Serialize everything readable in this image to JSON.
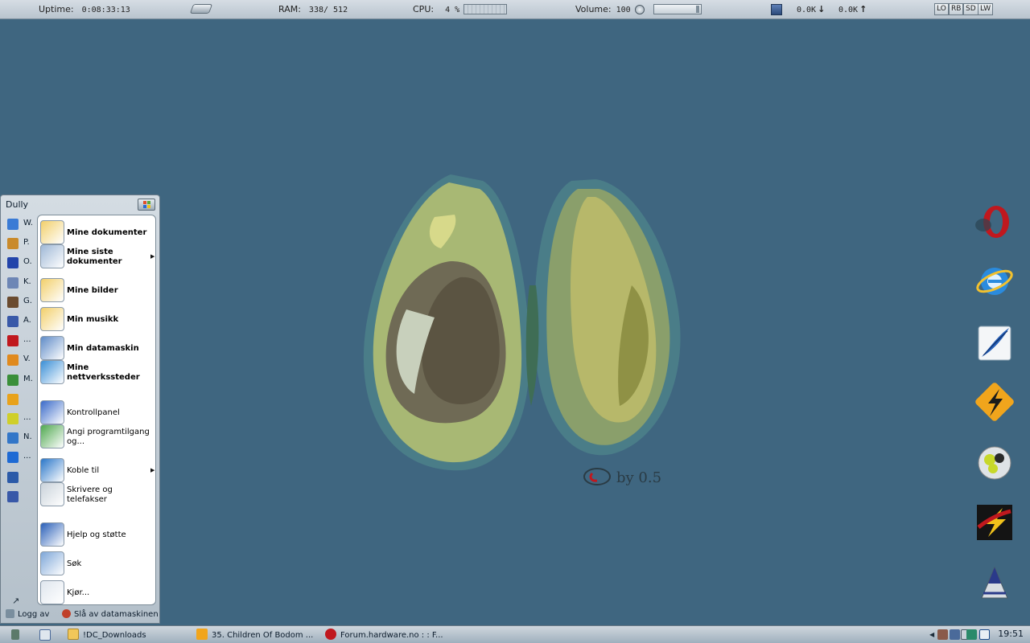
{
  "statusbar": {
    "uptime_label": "Uptime:",
    "uptime_value": "0:08:33:13",
    "ram_label": "RAM:",
    "ram_value": "338/ 512",
    "cpu_label": "CPU:",
    "cpu_value": "4 %",
    "volume_label": "Volume:",
    "volume_value": "100 %",
    "net_down": "0.0K",
    "net_up": "0.0K",
    "buttons": [
      "LO",
      "RB",
      "SD",
      "LW"
    ]
  },
  "wallpaper": {
    "signature": "by 0.5"
  },
  "dock": {
    "icons": [
      "opera-icon",
      "internet-explorer-icon",
      "feather-icon",
      "winamp-icon",
      "media-player-icon",
      "flashget-icon",
      "vlc-cone-icon"
    ]
  },
  "startmenu": {
    "user": "Dully",
    "left_items": [
      {
        "label": "W.",
        "icon": "windows-flag-icon",
        "color": "#3a7bd5"
      },
      {
        "label": "P.",
        "icon": "paint-icon",
        "color": "#c98a2b"
      },
      {
        "label": "O.",
        "icon": "calendar-icon",
        "color": "#2244aa"
      },
      {
        "label": "K.",
        "icon": "notepad-icon",
        "color": "#6d86b5"
      },
      {
        "label": "G.",
        "icon": "game-icon",
        "color": "#6a4b2f"
      },
      {
        "label": "A.",
        "icon": "app-icon",
        "color": "#3959a8"
      },
      {
        "label": "...",
        "icon": "opera-small-icon",
        "color": "#c0181e"
      },
      {
        "label": "V.",
        "icon": "vlc-small-icon",
        "color": "#e08a1e"
      },
      {
        "label": "M.",
        "icon": "messenger-icon",
        "color": "#3a8f3a"
      },
      {
        "label": "",
        "icon": "winamp-small-icon",
        "color": "#e8a21b"
      },
      {
        "label": "...",
        "icon": "media-small-icon",
        "color": "#cfcf2a"
      },
      {
        "label": "N.",
        "icon": "network-icon",
        "color": "#3276c8"
      },
      {
        "label": "...",
        "icon": "ie-small-icon",
        "color": "#1e6ad4"
      },
      {
        "label": "",
        "icon": "photoshop-icon",
        "color": "#2b5aa8"
      },
      {
        "label": "",
        "icon": "figure-icon",
        "color": "#3858a8"
      }
    ],
    "right_items": [
      {
        "label": "Mine dokumenter",
        "bold": true,
        "icon": "my-documents-icon",
        "arrow": false
      },
      {
        "label": "Mine siste dokumenter",
        "bold": true,
        "icon": "recent-documents-icon",
        "arrow": true
      },
      {
        "label": "Mine bilder",
        "bold": true,
        "icon": "my-pictures-icon",
        "arrow": false
      },
      {
        "label": "Min musikk",
        "bold": true,
        "icon": "my-music-icon",
        "arrow": false
      },
      {
        "label": "Min datamaskin",
        "bold": true,
        "icon": "my-computer-icon",
        "arrow": false
      },
      {
        "label": "Mine nettverkssteder",
        "bold": true,
        "icon": "network-places-icon",
        "arrow": false
      },
      {
        "label": "Kontrollpanel",
        "bold": false,
        "icon": "control-panel-icon",
        "arrow": false
      },
      {
        "label": "Angi programtilgang og...",
        "bold": false,
        "icon": "program-access-icon",
        "arrow": false
      },
      {
        "label": "Koble til",
        "bold": false,
        "icon": "connect-icon",
        "arrow": true
      },
      {
        "label": "Skrivere og telefakser",
        "bold": false,
        "icon": "printer-icon",
        "arrow": false
      },
      {
        "label": "Hjelp og støtte",
        "bold": false,
        "icon": "help-icon",
        "arrow": false
      },
      {
        "label": "Søk",
        "bold": false,
        "icon": "search-icon",
        "arrow": false
      },
      {
        "label": "Kjør...",
        "bold": false,
        "icon": "run-icon",
        "arrow": false
      }
    ],
    "all_programs_arrow": "↗",
    "logoff_label": "Logg av",
    "shutdown_label": "Slå av datamaskinen"
  },
  "taskbar": {
    "buttons": [
      {
        "label": "!DC_Downloads",
        "icon": "folder-icon"
      },
      {
        "label": "35. Children Of Bodom ...",
        "icon": "winamp-task-icon"
      },
      {
        "label": "Forum.hardware.no : : F...",
        "icon": "opera-task-icon"
      }
    ],
    "clock": "19:51"
  }
}
